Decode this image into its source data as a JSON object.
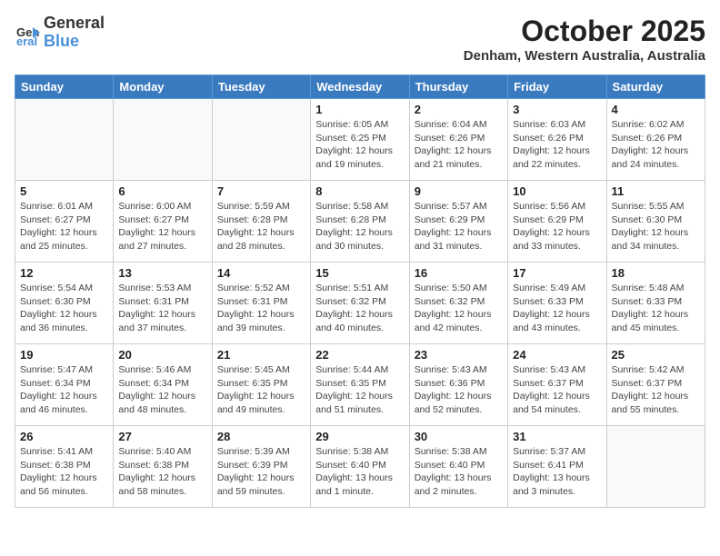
{
  "header": {
    "logo_general": "General",
    "logo_blue": "Blue",
    "month_title": "October 2025",
    "location": "Denham, Western Australia, Australia"
  },
  "weekdays": [
    "Sunday",
    "Monday",
    "Tuesday",
    "Wednesday",
    "Thursday",
    "Friday",
    "Saturday"
  ],
  "weeks": [
    [
      {
        "day": "",
        "info": ""
      },
      {
        "day": "",
        "info": ""
      },
      {
        "day": "",
        "info": ""
      },
      {
        "day": "1",
        "info": "Sunrise: 6:05 AM\nSunset: 6:25 PM\nDaylight: 12 hours\nand 19 minutes."
      },
      {
        "day": "2",
        "info": "Sunrise: 6:04 AM\nSunset: 6:26 PM\nDaylight: 12 hours\nand 21 minutes."
      },
      {
        "day": "3",
        "info": "Sunrise: 6:03 AM\nSunset: 6:26 PM\nDaylight: 12 hours\nand 22 minutes."
      },
      {
        "day": "4",
        "info": "Sunrise: 6:02 AM\nSunset: 6:26 PM\nDaylight: 12 hours\nand 24 minutes."
      }
    ],
    [
      {
        "day": "5",
        "info": "Sunrise: 6:01 AM\nSunset: 6:27 PM\nDaylight: 12 hours\nand 25 minutes."
      },
      {
        "day": "6",
        "info": "Sunrise: 6:00 AM\nSunset: 6:27 PM\nDaylight: 12 hours\nand 27 minutes."
      },
      {
        "day": "7",
        "info": "Sunrise: 5:59 AM\nSunset: 6:28 PM\nDaylight: 12 hours\nand 28 minutes."
      },
      {
        "day": "8",
        "info": "Sunrise: 5:58 AM\nSunset: 6:28 PM\nDaylight: 12 hours\nand 30 minutes."
      },
      {
        "day": "9",
        "info": "Sunrise: 5:57 AM\nSunset: 6:29 PM\nDaylight: 12 hours\nand 31 minutes."
      },
      {
        "day": "10",
        "info": "Sunrise: 5:56 AM\nSunset: 6:29 PM\nDaylight: 12 hours\nand 33 minutes."
      },
      {
        "day": "11",
        "info": "Sunrise: 5:55 AM\nSunset: 6:30 PM\nDaylight: 12 hours\nand 34 minutes."
      }
    ],
    [
      {
        "day": "12",
        "info": "Sunrise: 5:54 AM\nSunset: 6:30 PM\nDaylight: 12 hours\nand 36 minutes."
      },
      {
        "day": "13",
        "info": "Sunrise: 5:53 AM\nSunset: 6:31 PM\nDaylight: 12 hours\nand 37 minutes."
      },
      {
        "day": "14",
        "info": "Sunrise: 5:52 AM\nSunset: 6:31 PM\nDaylight: 12 hours\nand 39 minutes."
      },
      {
        "day": "15",
        "info": "Sunrise: 5:51 AM\nSunset: 6:32 PM\nDaylight: 12 hours\nand 40 minutes."
      },
      {
        "day": "16",
        "info": "Sunrise: 5:50 AM\nSunset: 6:32 PM\nDaylight: 12 hours\nand 42 minutes."
      },
      {
        "day": "17",
        "info": "Sunrise: 5:49 AM\nSunset: 6:33 PM\nDaylight: 12 hours\nand 43 minutes."
      },
      {
        "day": "18",
        "info": "Sunrise: 5:48 AM\nSunset: 6:33 PM\nDaylight: 12 hours\nand 45 minutes."
      }
    ],
    [
      {
        "day": "19",
        "info": "Sunrise: 5:47 AM\nSunset: 6:34 PM\nDaylight: 12 hours\nand 46 minutes."
      },
      {
        "day": "20",
        "info": "Sunrise: 5:46 AM\nSunset: 6:34 PM\nDaylight: 12 hours\nand 48 minutes."
      },
      {
        "day": "21",
        "info": "Sunrise: 5:45 AM\nSunset: 6:35 PM\nDaylight: 12 hours\nand 49 minutes."
      },
      {
        "day": "22",
        "info": "Sunrise: 5:44 AM\nSunset: 6:35 PM\nDaylight: 12 hours\nand 51 minutes."
      },
      {
        "day": "23",
        "info": "Sunrise: 5:43 AM\nSunset: 6:36 PM\nDaylight: 12 hours\nand 52 minutes."
      },
      {
        "day": "24",
        "info": "Sunrise: 5:43 AM\nSunset: 6:37 PM\nDaylight: 12 hours\nand 54 minutes."
      },
      {
        "day": "25",
        "info": "Sunrise: 5:42 AM\nSunset: 6:37 PM\nDaylight: 12 hours\nand 55 minutes."
      }
    ],
    [
      {
        "day": "26",
        "info": "Sunrise: 5:41 AM\nSunset: 6:38 PM\nDaylight: 12 hours\nand 56 minutes."
      },
      {
        "day": "27",
        "info": "Sunrise: 5:40 AM\nSunset: 6:38 PM\nDaylight: 12 hours\nand 58 minutes."
      },
      {
        "day": "28",
        "info": "Sunrise: 5:39 AM\nSunset: 6:39 PM\nDaylight: 12 hours\nand 59 minutes."
      },
      {
        "day": "29",
        "info": "Sunrise: 5:38 AM\nSunset: 6:40 PM\nDaylight: 13 hours\nand 1 minute."
      },
      {
        "day": "30",
        "info": "Sunrise: 5:38 AM\nSunset: 6:40 PM\nDaylight: 13 hours\nand 2 minutes."
      },
      {
        "day": "31",
        "info": "Sunrise: 5:37 AM\nSunset: 6:41 PM\nDaylight: 13 hours\nand 3 minutes."
      },
      {
        "day": "",
        "info": ""
      }
    ]
  ]
}
